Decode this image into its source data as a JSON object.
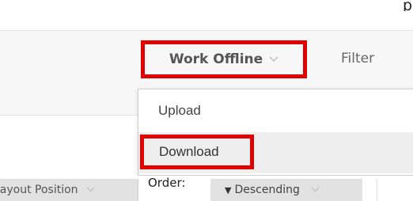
{
  "top": {
    "partial_text": "p"
  },
  "toolbar": {
    "work_offline_label": "Work Offline",
    "work_offline_chevron_icon": "chevron-down-icon",
    "filter_label": "Filter"
  },
  "dropdown": {
    "items": [
      {
        "label": "Upload"
      },
      {
        "label": "Download"
      }
    ]
  },
  "table_header": {
    "layout_position_label": "Layout Position",
    "order_label": "Order:",
    "sort_arrow": "▼",
    "sort_label": "Descending"
  },
  "colors": {
    "highlight_border": "#e10000",
    "toolbar_bg": "#f7f7f7",
    "header_bg": "#e2e2e2"
  }
}
